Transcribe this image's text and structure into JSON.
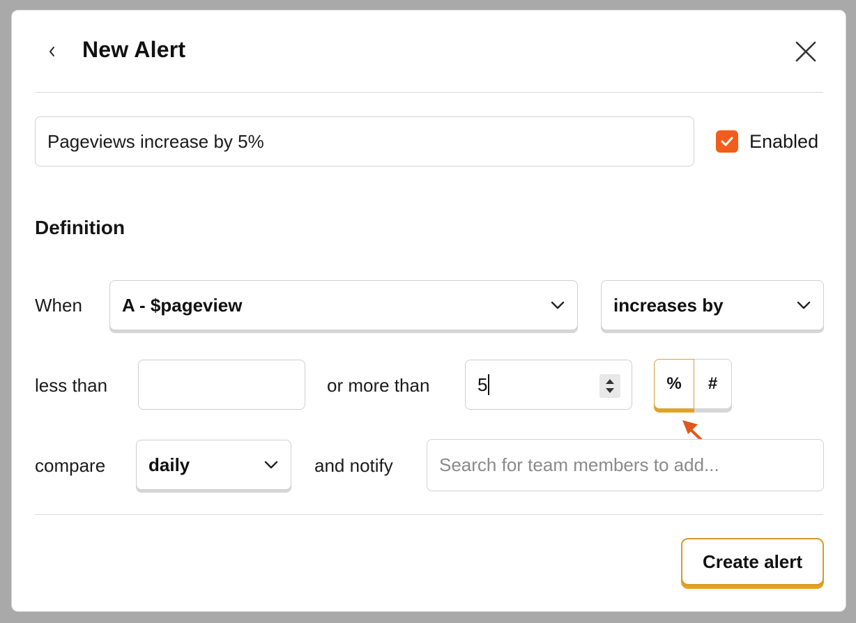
{
  "modal": {
    "title": "New Alert",
    "back_icon": "chevron-left-icon",
    "close_icon": "close-icon"
  },
  "alert_name": {
    "value": "Pageviews increase by 5%"
  },
  "enabled": {
    "label": "Enabled",
    "checked": true,
    "color": "#f35d1c"
  },
  "definition": {
    "title": "Definition",
    "when_label": "When",
    "series_value": "A - $pageview",
    "condition_value": "increases by",
    "less_than_label": "less than",
    "less_than_value": "",
    "or_more_than_label": "or more than",
    "more_than_value": "5",
    "unit_options": [
      "%",
      "#"
    ],
    "unit_selected": "%",
    "compare_label": "compare",
    "compare_value": "daily",
    "notify_label": "and notify",
    "notify_placeholder": "Search for team members to add..."
  },
  "footer": {
    "create_label": "Create alert"
  },
  "colors": {
    "accent": "#f35d1c",
    "highlight": "#e3a224"
  }
}
